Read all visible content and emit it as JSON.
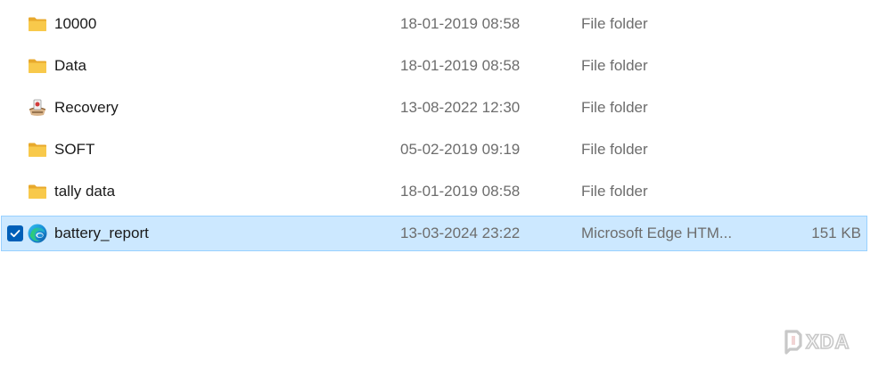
{
  "files": [
    {
      "name": "10000",
      "date": "18-01-2019 08:58",
      "type": "File folder",
      "size": "",
      "icon": "folder-icon"
    },
    {
      "name": "Data",
      "date": "18-01-2019 08:58",
      "type": "File folder",
      "size": "",
      "icon": "folder-icon"
    },
    {
      "name": "Recovery",
      "date": "13-08-2022 12:30",
      "type": "File folder",
      "size": "",
      "icon": "recovery-folder-icon"
    },
    {
      "name": "SOFT",
      "date": "05-02-2019 09:19",
      "type": "File folder",
      "size": "",
      "icon": "folder-icon"
    },
    {
      "name": "tally data",
      "date": "18-01-2019 08:58",
      "type": "File folder",
      "size": "",
      "icon": "folder-icon"
    },
    {
      "name": "battery_report",
      "date": "13-03-2024 23:22",
      "type": "Microsoft Edge HTM...",
      "size": "151 KB",
      "icon": "edge-icon",
      "selected": true
    }
  ],
  "watermark": {
    "text": "XDA"
  },
  "colors": {
    "selection_bg": "#cce8ff",
    "selection_border": "#99d1ff",
    "checkbox": "#005fb8",
    "folder": "#f8c94b",
    "meta_text": "#6d6d6d"
  }
}
